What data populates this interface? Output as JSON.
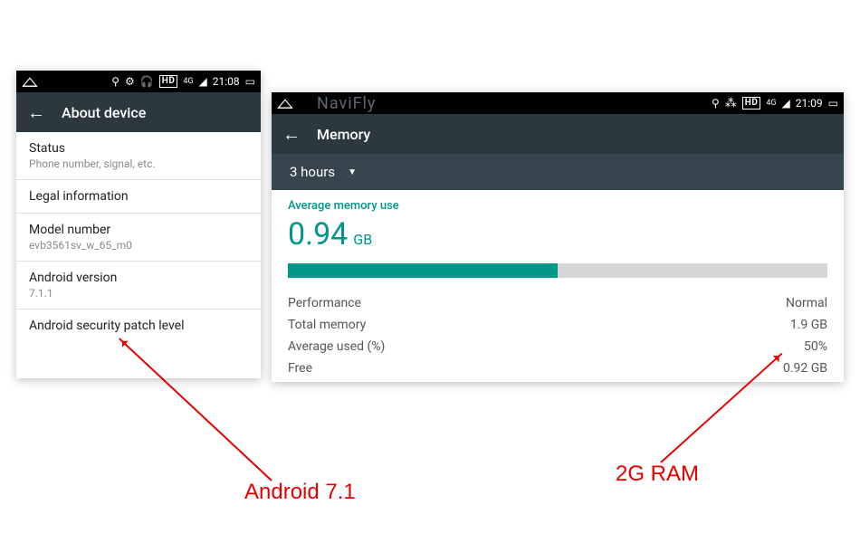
{
  "left": {
    "appbar": {
      "title": "About device"
    },
    "statusbar": {
      "time": "21:08",
      "net_label": "4G",
      "hd_label": "HD"
    },
    "rows": [
      {
        "primary": "Status",
        "secondary": "Phone number, signal, etc."
      },
      {
        "primary": "Legal information",
        "secondary": ""
      },
      {
        "primary": "Model number",
        "secondary": "evb3561sv_w_65_m0"
      },
      {
        "primary": "Android version",
        "secondary": "7.1.1"
      },
      {
        "primary": "Android security patch level",
        "secondary": ""
      }
    ]
  },
  "right": {
    "appbar": {
      "title": "Memory"
    },
    "statusbar": {
      "time": "21:09",
      "net_label": "4G",
      "hd_label": "HD"
    },
    "subheader": {
      "range": "3 hours"
    },
    "caption": "Average memory use",
    "value": "0.94",
    "unit": "GB",
    "bar_percent": 50,
    "kv": [
      {
        "k": "Performance",
        "v": "Normal"
      },
      {
        "k": "Total memory",
        "v": "1.9 GB"
      },
      {
        "k": "Average used (%)",
        "v": "50%"
      },
      {
        "k": "Free",
        "v": "0.92 GB"
      }
    ]
  },
  "callouts": {
    "android": "Android 7.1",
    "ram": "2G RAM"
  },
  "watermark": "NaviFly"
}
